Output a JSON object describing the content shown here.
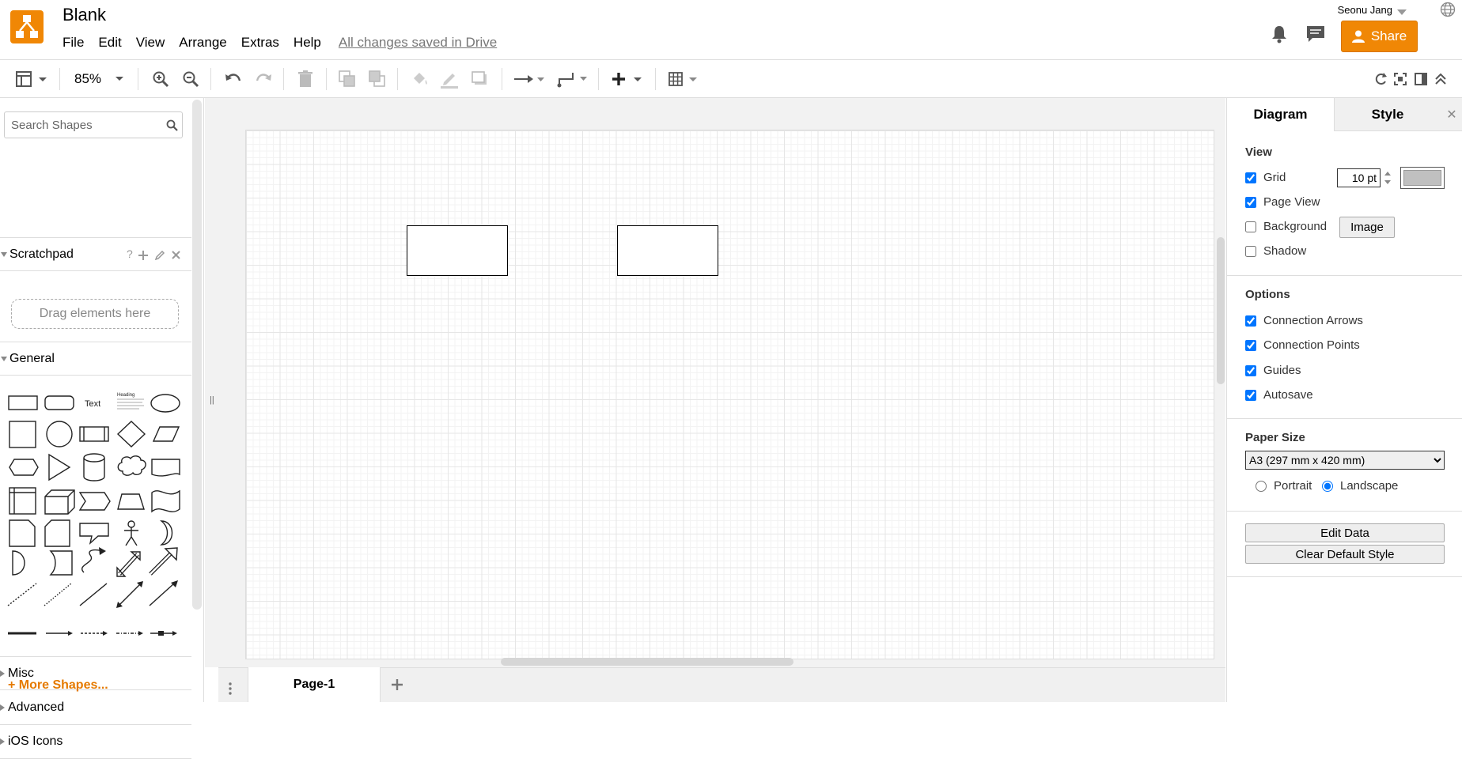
{
  "app": {
    "title": "Blank",
    "menus": [
      "File",
      "Edit",
      "View",
      "Arrange",
      "Extras",
      "Help"
    ],
    "save_status": "All changes saved in Drive",
    "user": "Seonu Jang",
    "share_label": "Share",
    "accent_color": "#f08705"
  },
  "toolbar": {
    "zoom": "85%"
  },
  "sidebar": {
    "search_placeholder": "Search Shapes",
    "scratchpad_label": "Scratchpad",
    "scratchpad_icons": [
      "help-icon",
      "add-icon",
      "edit-icon",
      "close-icon"
    ],
    "drag_hint": "Drag elements here",
    "general_label": "General",
    "general_text_shape": "Text",
    "general_heading_shape": "Heading",
    "misc_label": "Misc",
    "advanced_label": "Advanced",
    "ios_label": "iOS Icons",
    "more_shapes": "+ More Shapes..."
  },
  "canvas": {
    "page_tab": "Page-1"
  },
  "format_panel": {
    "tabs": [
      "Diagram",
      "Style"
    ],
    "view_title": "View",
    "grid_label": "Grid",
    "grid_checked": true,
    "grid_size": "10 pt",
    "grid_color": "#c0c0c0",
    "page_view_label": "Page View",
    "page_view_checked": true,
    "background_label": "Background",
    "background_checked": false,
    "image_button": "Image",
    "shadow_label": "Shadow",
    "shadow_checked": false,
    "options_title": "Options",
    "connection_arrows_label": "Connection Arrows",
    "connection_points_label": "Connection Points",
    "guides_label": "Guides",
    "autosave_label": "Autosave",
    "paper_size_title": "Paper Size",
    "paper_size_value": "A3 (297 mm x 420 mm)",
    "portrait_label": "Portrait",
    "landscape_label": "Landscape",
    "orientation": "Landscape",
    "edit_data_button": "Edit Data",
    "clear_style_button": "Clear Default Style"
  }
}
